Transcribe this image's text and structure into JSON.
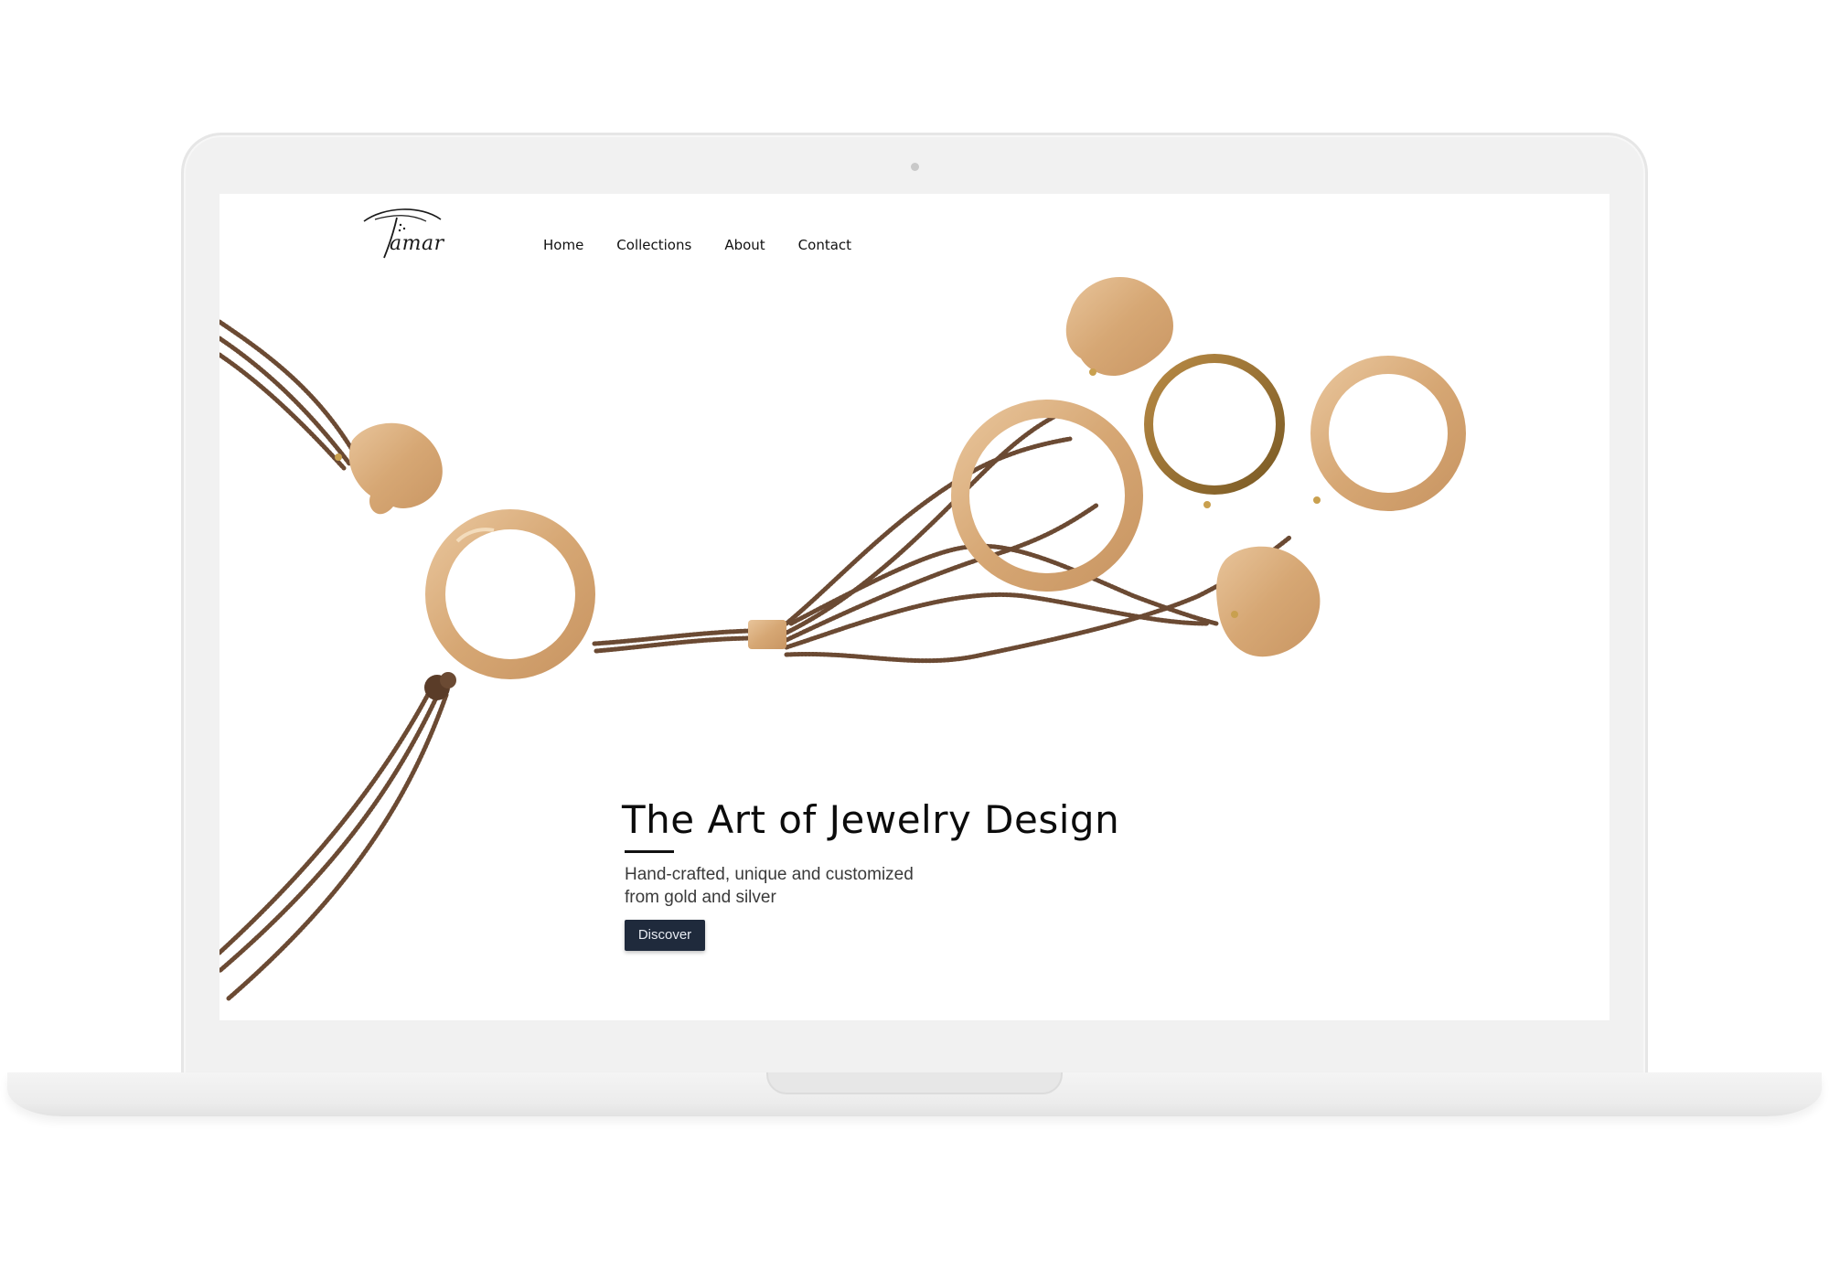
{
  "brand": {
    "logo_text": "amar"
  },
  "nav": {
    "items": [
      {
        "label": "Home"
      },
      {
        "label": "Collections"
      },
      {
        "label": "About"
      },
      {
        "label": "Contact"
      }
    ]
  },
  "hero": {
    "title": "The Art of Jewelry Design",
    "subtitle_line1": "Hand-crafted, unique and customized",
    "subtitle_line2": "from gold and silver",
    "cta_label": "Discover"
  },
  "colors": {
    "button_bg": "#1f2a3c",
    "gold": "#d9ad7c",
    "bead_chain": "#6b4a33"
  }
}
